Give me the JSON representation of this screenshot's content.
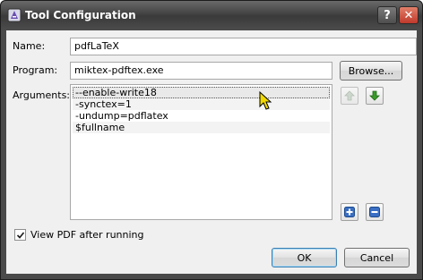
{
  "window": {
    "title": "Tool Configuration",
    "help_glyph": "?",
    "close_glyph": "✕"
  },
  "form": {
    "name_label": "Name:",
    "name_value": "pdfLaTeX",
    "program_label": "Program:",
    "program_value": "miktex-pdftex.exe",
    "browse_label": "Browse...",
    "arguments_label": "Arguments:",
    "arguments": [
      {
        "text": "--enable-write18",
        "selected": true
      },
      {
        "text": "-synctex=1",
        "selected": false
      },
      {
        "text": "-undump=pdflatex",
        "selected": false
      },
      {
        "text": "$fullname",
        "selected": false
      }
    ],
    "view_pdf_label": "View PDF after running",
    "view_pdf_checked": true
  },
  "buttons": {
    "ok_label": "OK",
    "cancel_label": "Cancel"
  },
  "icons": {
    "move_up": "arrow-up-icon",
    "move_down": "arrow-down-icon",
    "add": "plus-icon",
    "remove": "minus-icon"
  },
  "colors": {
    "accent_green": "#3a9a2a",
    "accent_blue": "#3a6fc4",
    "title_bar": "#4a4a4a"
  }
}
